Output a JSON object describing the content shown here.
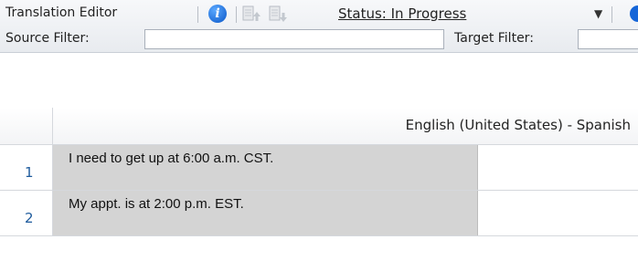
{
  "toolbar": {
    "title": "Translation Editor",
    "info_icon_glyph": "i",
    "status_label": "Status: In Progress",
    "dropdown_arrow": "▼",
    "source_filter_label": "Source Filter:",
    "target_filter_label": "Target Filter:",
    "source_filter_value": "",
    "target_filter_value": ""
  },
  "grid": {
    "column_header": "English (United States) - Spanish",
    "rows": [
      {
        "number": "1",
        "source": "I need to get up at 6:00 a.m. CST.",
        "target": ""
      },
      {
        "number": "2",
        "source": "My appt. is at 2:00 p.m. EST.",
        "target": ""
      }
    ]
  },
  "colors": {
    "source_cell_bg": "#d4d4d4",
    "row_number_color": "#1d5a9c",
    "info_icon_blue": "#1565d8"
  },
  "icons": [
    "info-icon",
    "move-up-icon",
    "move-down-icon",
    "dropdown-arrow-icon"
  ]
}
